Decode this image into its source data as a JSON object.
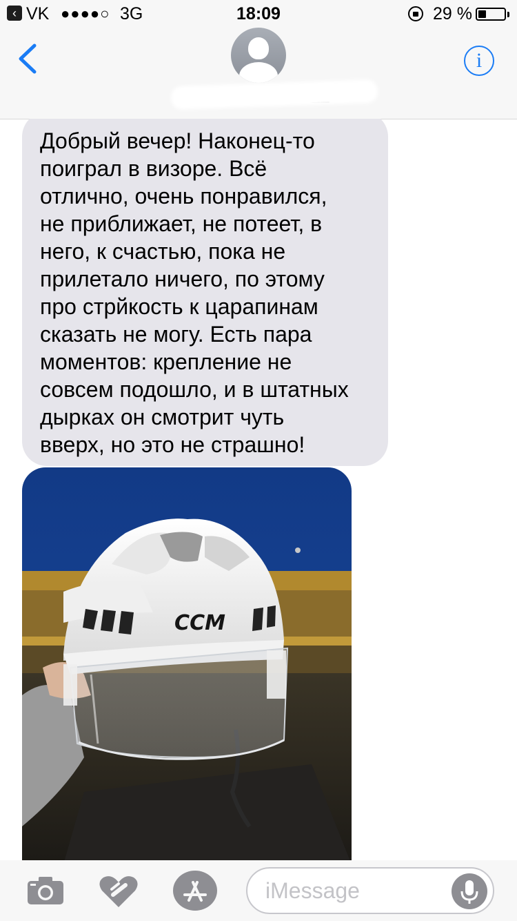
{
  "status_bar": {
    "back_app_arrow": "‹",
    "back_app": "VK",
    "signal_dots": "●●●●○",
    "network": "3G",
    "time": "18:09",
    "battery_percent": "29 %",
    "battery_level": 0.29
  },
  "nav": {
    "back_icon": "chevron-left-icon",
    "avatar_icon": "person-icon",
    "contact_number": "+7 (9__) 2__-__-__",
    "info_label": "i"
  },
  "conversation": {
    "incoming_message": "Добрый вечер! Наконец-то\nпоиграл в визоре. Всё\nотлично, очень понравился,\nне приближает, не потеет, в\nнего, к счастью, пока не\nприлетало ничего, по этому\nпро стрйкость к царапинам\nсказать не могу. Есть пара\nмоментов: крепление не\nсовсем подошло, и в штатных\nдырках он смотрит чуть\nвверх, но это не страшно!",
    "photo_brand": "CCM"
  },
  "input_bar": {
    "camera_icon": "camera-icon",
    "digital_touch_icon": "digital-touch-heart-icon",
    "apps_icon": "app-store-icon",
    "placeholder": "iMessage",
    "mic_icon": "microphone-icon"
  },
  "colors": {
    "accent": "#1a7cf5",
    "bubble_incoming": "#e6e5eb",
    "bar_background": "#f7f7f7"
  }
}
